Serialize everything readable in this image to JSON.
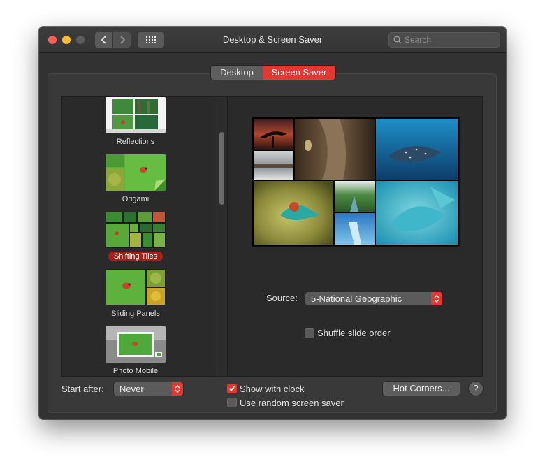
{
  "window": {
    "title": "Desktop & Screen Saver"
  },
  "toolbar": {
    "back_icon": "chevron-left-icon",
    "forward_icon": "chevron-right-icon",
    "show_all_icon": "grid-icon",
    "search_placeholder": "Search"
  },
  "tabs": [
    {
      "label": "Desktop",
      "selected": false
    },
    {
      "label": "Screen Saver",
      "selected": true
    }
  ],
  "savers": [
    {
      "label": "Reflections",
      "selected": false
    },
    {
      "label": "Origami",
      "selected": false
    },
    {
      "label": "Shifting Tiles",
      "selected": true
    },
    {
      "label": "Sliding Panels",
      "selected": false
    },
    {
      "label": "Photo Mobile",
      "selected": false
    }
  ],
  "options": {
    "source_label": "Source:",
    "source_value": "5-National Geographic",
    "shuffle_label": "Shuffle slide order",
    "shuffle_checked": false
  },
  "footer": {
    "start_after_label": "Start after:",
    "start_after_value": "Never",
    "show_clock_label": "Show with clock",
    "show_clock_checked": true,
    "random_label": "Use random screen saver",
    "random_checked": false,
    "hot_corners_label": "Hot Corners...",
    "help_label": "?"
  },
  "colors": {
    "accent": "#e23a32",
    "selection": "#a0211c",
    "window_bg": "#323232"
  }
}
